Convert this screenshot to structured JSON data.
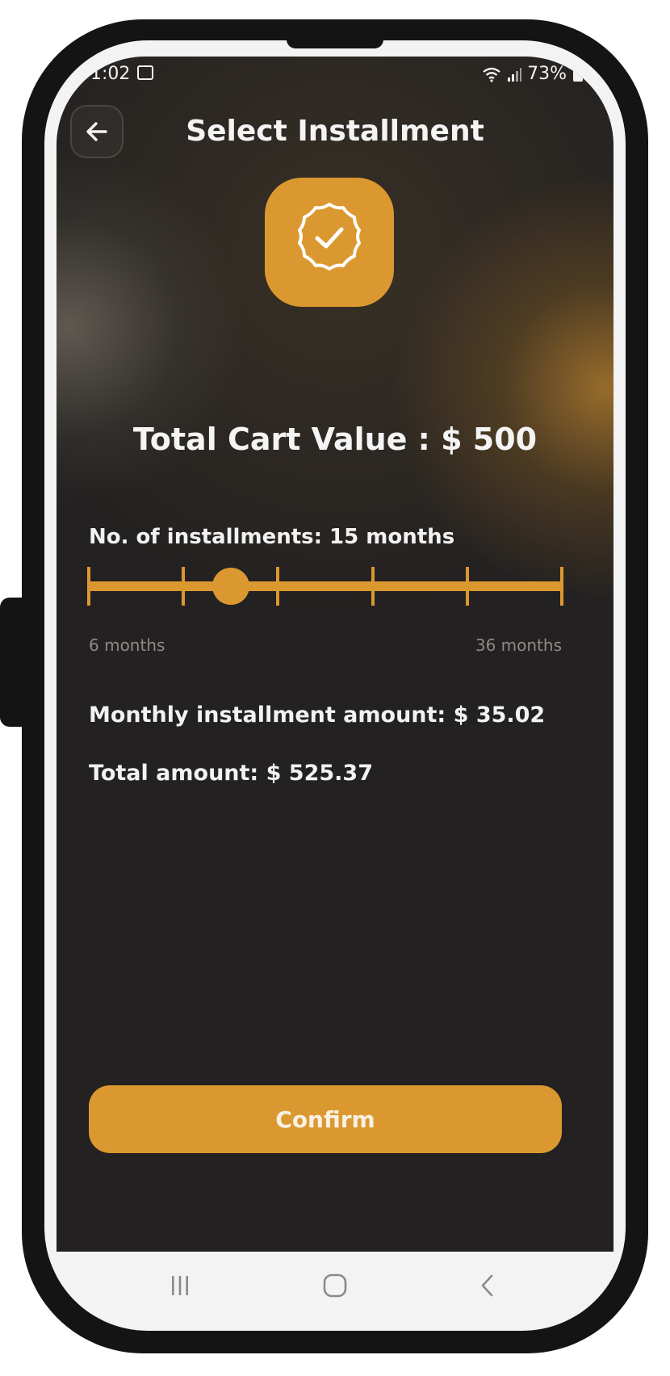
{
  "status_bar": {
    "time": "1:02",
    "battery": "73%"
  },
  "header": {
    "title": "Select Installment"
  },
  "cart": {
    "total_text": "Total Cart Value : $ 500"
  },
  "installments": {
    "label": "No. of installments: 15 months",
    "slider": {
      "min_label": "6 months",
      "max_label": "36 months",
      "min_value": 6,
      "max_value": 36,
      "step": 6,
      "value": 15
    }
  },
  "summary": {
    "monthly_text": "Monthly installment amount: $ 35.02",
    "total_text": "Total amount: $ 525.37"
  },
  "actions": {
    "confirm_label": "Confirm"
  },
  "colors": {
    "accent": "#dc9830",
    "background": "#232121",
    "text": "#f2f2f2",
    "muted_text": "#8e8a84"
  },
  "icons": {
    "back": "arrow-left-icon",
    "badge": "verified-badge-icon",
    "nav_recents": "recents-icon",
    "nav_home": "home-icon",
    "nav_back": "chevron-left-icon"
  }
}
